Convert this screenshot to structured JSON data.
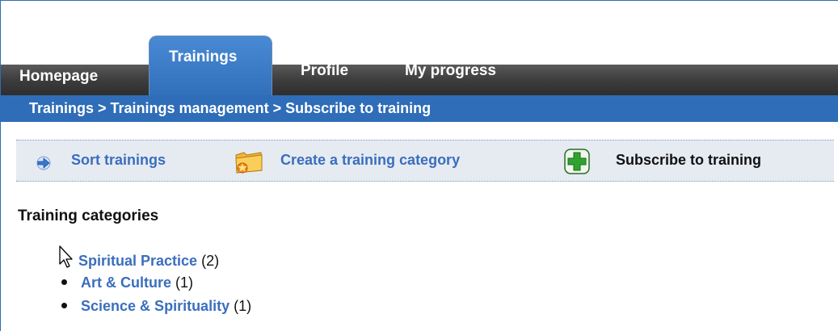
{
  "nav": {
    "tabs": [
      {
        "label": "Homepage",
        "active": false
      },
      {
        "label": "Trainings",
        "active": true
      },
      {
        "label": "Profile",
        "active": false
      },
      {
        "label": "My progress",
        "active": false
      }
    ]
  },
  "breadcrumb": "Trainings > Trainings management > Subscribe to training",
  "toolbar": {
    "sort_label": "Sort trainings",
    "sort_icon": "arrow-right-icon",
    "create_label": "Create a training category",
    "create_icon": "folder-icon",
    "subscribe_label": "Subscribe to training",
    "subscribe_icon": "plus-icon"
  },
  "section_title": "Training categories",
  "categories": [
    {
      "name": "Spiritual Practice",
      "count": "(2)"
    },
    {
      "name": "Art & Culture",
      "count": "(1)"
    },
    {
      "name": "Science & Spirituality",
      "count": "(1)"
    }
  ],
  "colors": {
    "nav_dark": "#3d3d3d",
    "accent_blue": "#2f6db8",
    "link_blue": "#3a6ebd",
    "toolbar_bg": "#e6ebf2",
    "plus_green": "#2fa32f"
  }
}
